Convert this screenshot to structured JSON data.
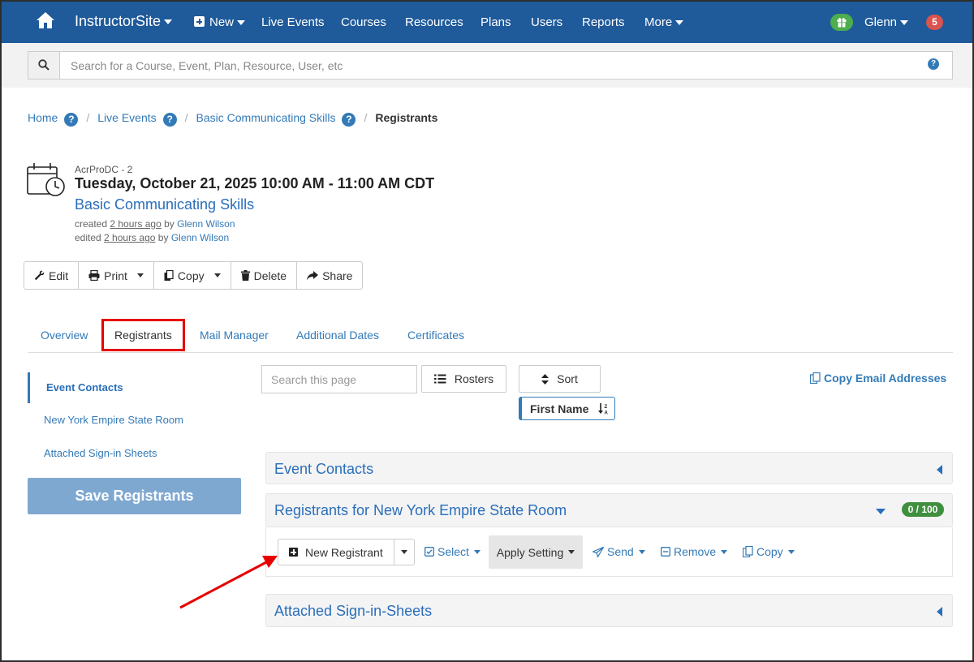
{
  "nav": {
    "brand": "InstructorSite",
    "new_label": "New",
    "items": [
      "Live Events",
      "Courses",
      "Resources",
      "Plans",
      "Users",
      "Reports"
    ],
    "more_label": "More",
    "user_label": "Glenn",
    "notification_count": "5",
    "bar_color": "#1f5a9a"
  },
  "search": {
    "placeholder": "Search for a Course, Event, Plan, Resource, User, etc"
  },
  "breadcrumb": {
    "home": "Home",
    "live_events": "Live Events",
    "event": "Basic Communicating Skills",
    "current": "Registrants",
    "help": "?"
  },
  "event": {
    "org": "AcrProDC - 2",
    "datetime": "Tuesday, October 21, 2025 10:00 AM - 11:00 AM CDT",
    "name": "Basic Communicating Skills",
    "created_prefix": "created",
    "created_time": "2 hours ago",
    "created_by_prefix": "by",
    "created_by": "Glenn Wilson",
    "edited_prefix": "edited",
    "edited_time": "2 hours ago",
    "edited_by_prefix": "by",
    "edited_by": "Glenn Wilson"
  },
  "actions": {
    "edit": "Edit",
    "print": "Print",
    "copy": "Copy",
    "delete": "Delete",
    "share": "Share"
  },
  "tabs": {
    "overview": "Overview",
    "registrants": "Registrants",
    "mail_manager": "Mail Manager",
    "additional_dates": "Additional Dates",
    "certificates": "Certificates",
    "active": "Registrants"
  },
  "leftnav": {
    "event_contacts": "Event Contacts",
    "room": "New York Empire State Room",
    "signin": "Attached Sign-in Sheets",
    "save": "Save Registrants"
  },
  "toolbar": {
    "search_placeholder": "Search this page",
    "rosters": "Rosters",
    "sort": "Sort",
    "sort_field": "First Name",
    "copy_emails": "Copy Email Addresses"
  },
  "panels": {
    "event_contacts": "Event Contacts",
    "room_registrants": "Registrants for New York Empire State Room",
    "count": "0 / 100",
    "signin_sheets": "Attached Sign-in-Sheets"
  },
  "registrant_actions": {
    "new_registrant": "New Registrant",
    "select": "Select",
    "apply_setting": "Apply Setting",
    "send": "Send",
    "remove": "Remove",
    "copy": "Copy"
  },
  "colors": {
    "link": "#337ab7",
    "highlight_box": "#e60000",
    "count_badge": "#3f8f3f",
    "save_button": "#7fa8d1"
  }
}
